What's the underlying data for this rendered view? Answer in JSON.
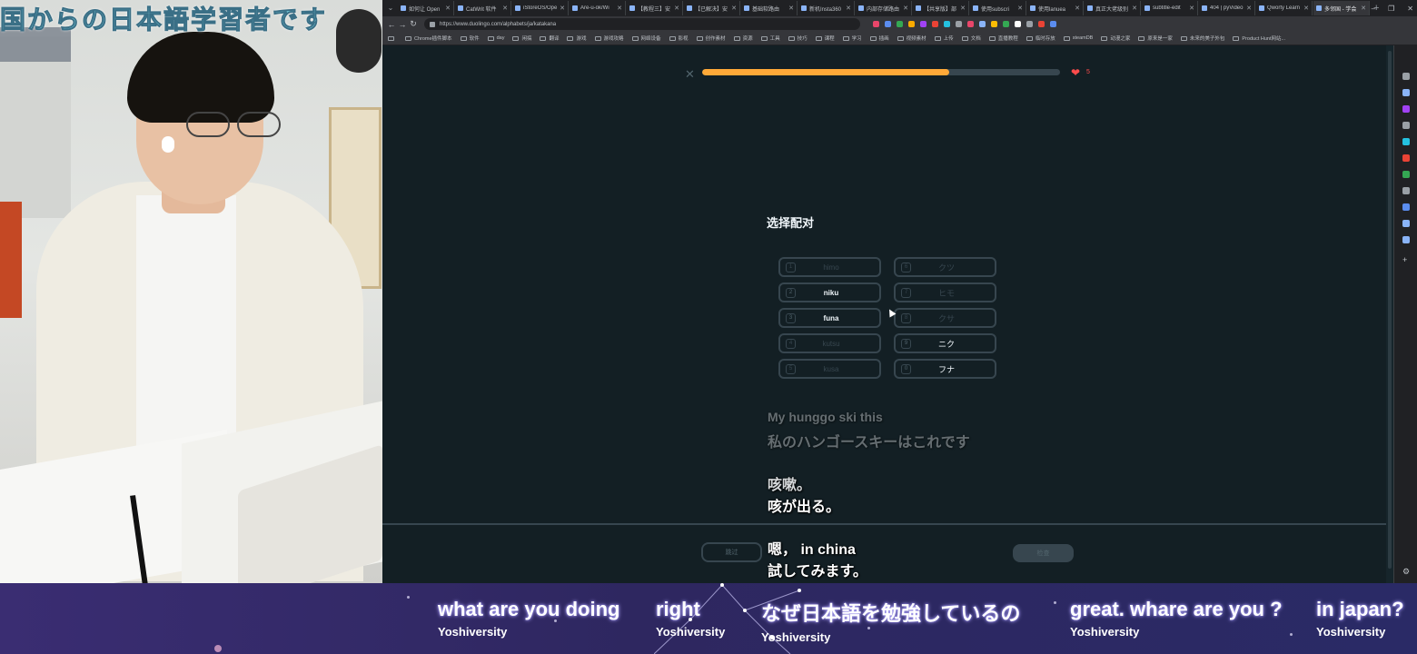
{
  "webcam": {
    "overlay_title": "国からの日本語学習者です"
  },
  "browser": {
    "tabs": [
      {
        "title": "如何让 Open"
      },
      {
        "title": "CatWrit 软件"
      },
      {
        "title": "iStoreOS/Ope"
      },
      {
        "title": "Are-u-ok/Wi"
      },
      {
        "title": "【教程三】安"
      },
      {
        "title": "【已解决】安"
      },
      {
        "title": "基础软路由"
      },
      {
        "title": "新机Insta360"
      },
      {
        "title": "内部存储路由"
      },
      {
        "title": "【共享版】部"
      },
      {
        "title": "使用subscri"
      },
      {
        "title": "使用lanuea"
      },
      {
        "title": "真正大佬级别"
      },
      {
        "title": "subtitle-edit"
      },
      {
        "title": "404 | pyVideo"
      },
      {
        "title": "Qworty Learn"
      },
      {
        "title": "多邻国 - 学会"
      }
    ],
    "active_tab_index": 16,
    "url": "https://www.duolingo.com/alphabets/ja/katakana",
    "bookmarks": [
      "Chrome插件脚本",
      "软件",
      "day",
      "闲搞",
      "翻译",
      "游戏",
      "游戏攻略",
      "网络设备",
      "影视",
      "创作素材",
      "资源",
      "工具",
      "技巧",
      "课程",
      "学习",
      "插画",
      "视频素材",
      "上传",
      "文档",
      "直播教程",
      "临时存放",
      "steamDB",
      "动漫之家",
      "原来是一家",
      "未来的美子外包",
      "Product Hunt网站..."
    ]
  },
  "lesson": {
    "progress_fraction": 0.69,
    "hearts": "5",
    "prompt": "选择配对",
    "left_choices": [
      {
        "key": "1",
        "label": "himo",
        "state": "matched"
      },
      {
        "key": "2",
        "label": "niku",
        "state": "active"
      },
      {
        "key": "3",
        "label": "funa",
        "state": "active"
      },
      {
        "key": "4",
        "label": "kutsu",
        "state": "matched"
      },
      {
        "key": "5",
        "label": "kusa",
        "state": "matched"
      }
    ],
    "right_choices": [
      {
        "key": "6",
        "label": "クツ",
        "state": "matched"
      },
      {
        "key": "7",
        "label": "ヒモ",
        "state": "matched"
      },
      {
        "key": "8",
        "label": "クサ",
        "state": "matched"
      },
      {
        "key": "9",
        "label": "ニク",
        "state": "active"
      },
      {
        "key": "0",
        "label": "フナ",
        "state": "active"
      }
    ],
    "skip_label": "跳过",
    "check_label": "检查"
  },
  "subtitles": {
    "line1": "My hunggo ski this",
    "line2": "私のハンゴースキーはこれです",
    "line3": "咳嗽。",
    "line4": "咳が出る。",
    "line5": "嗯， in china",
    "line6": "試してみます。"
  },
  "chat": [
    {
      "text": "what are you doing",
      "author": "Yoshiversity"
    },
    {
      "text": "right",
      "author": "Yoshiversity"
    },
    {
      "text": "なぜ日本語を勉強しているの",
      "author": "Yoshiversity"
    },
    {
      "text": "great. whare are you ?",
      "author": "Yoshiversity"
    },
    {
      "text": "in japan?",
      "author": "Yoshiversity"
    }
  ],
  "colors": {
    "progress": "#ffa938",
    "heart": "#ff4b4b",
    "page_bg": "#131f24",
    "border": "#37464f"
  }
}
